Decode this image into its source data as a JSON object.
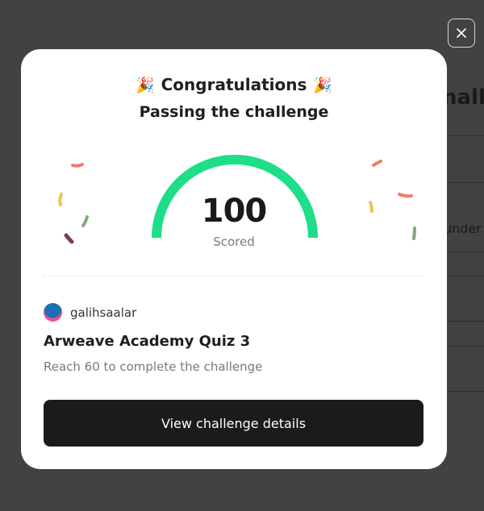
{
  "background": {
    "title_fragment": "nall",
    "row_fragment": "under"
  },
  "close_button": {
    "icon": "close-icon"
  },
  "modal": {
    "title": "Congratulations",
    "title_icon": "party-popper-icon",
    "subtitle": "Passing the challenge",
    "score": "100",
    "score_label": "Scored",
    "score_fraction": 1.0,
    "gauge_color": "#1ede89",
    "user": {
      "name": "galihsaalar",
      "avatar": "avatar"
    },
    "quiz_title": "Arweave Academy Quiz 3",
    "quiz_description": "Reach 60 to complete the challenge",
    "cta_label": "View challenge details"
  },
  "colors": {
    "overlay": "#424242",
    "button_bg": "#1c1b1b"
  }
}
